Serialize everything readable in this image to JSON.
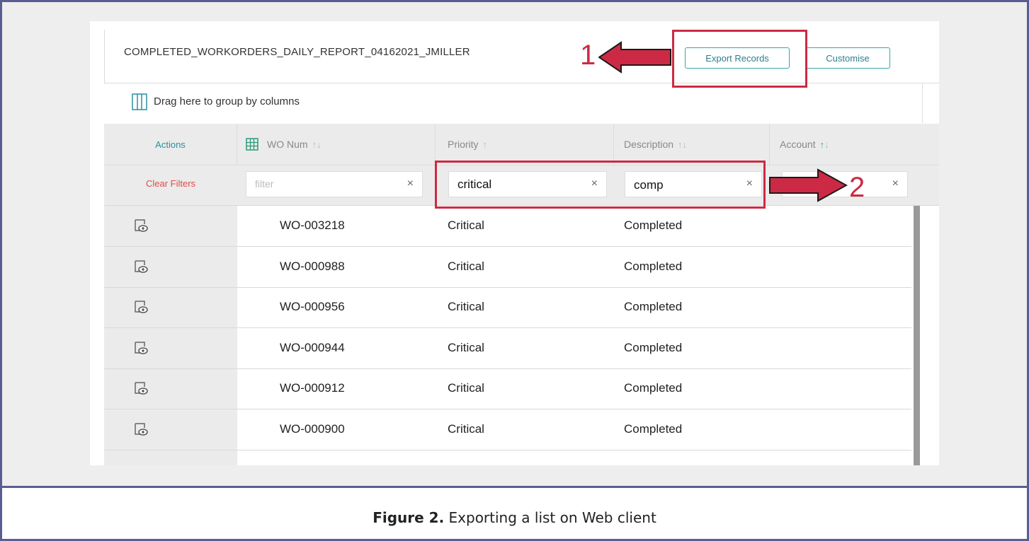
{
  "report": {
    "title": "COMPLETED_WORKORDERS_DAILY_REPORT_04162021_JMILLER",
    "export_label": "Export Records",
    "customise_label": "Customise"
  },
  "group_bar": {
    "text": "Drag here to group by columns"
  },
  "columns": {
    "actions": "Actions",
    "wo_num": "WO Num",
    "priority": "Priority",
    "description": "Description",
    "account": "Account"
  },
  "filters": {
    "clear_label": "Clear Filters",
    "wo_num_placeholder": "filter",
    "priority_value": "critical",
    "description_value": "comp",
    "clear_glyph": "×"
  },
  "rows": [
    {
      "wo": "WO-003218",
      "priority": "Critical",
      "description": "Completed"
    },
    {
      "wo": "WO-000988",
      "priority": "Critical",
      "description": "Completed"
    },
    {
      "wo": "WO-000956",
      "priority": "Critical",
      "description": "Completed"
    },
    {
      "wo": "WO-000944",
      "priority": "Critical",
      "description": "Completed"
    },
    {
      "wo": "WO-000912",
      "priority": "Critical",
      "description": "Completed"
    },
    {
      "wo": "WO-000900",
      "priority": "Critical",
      "description": "Completed"
    }
  ],
  "annotations": {
    "callout_1": "1",
    "callout_2": "2"
  },
  "caption": {
    "label": "Figure 2.",
    "text": "Exporting a list on Web client"
  },
  "colors": {
    "accent_teal": "#3aa5a9",
    "annotation_red": "#cc2a44",
    "clear_filters_red": "#e04a4a",
    "frame": "#5b5c91"
  },
  "icons": {
    "group": "columns-icon",
    "grid": "grid-icon",
    "row_action": "view-record-icon",
    "sort": "sort-arrows-icon"
  }
}
